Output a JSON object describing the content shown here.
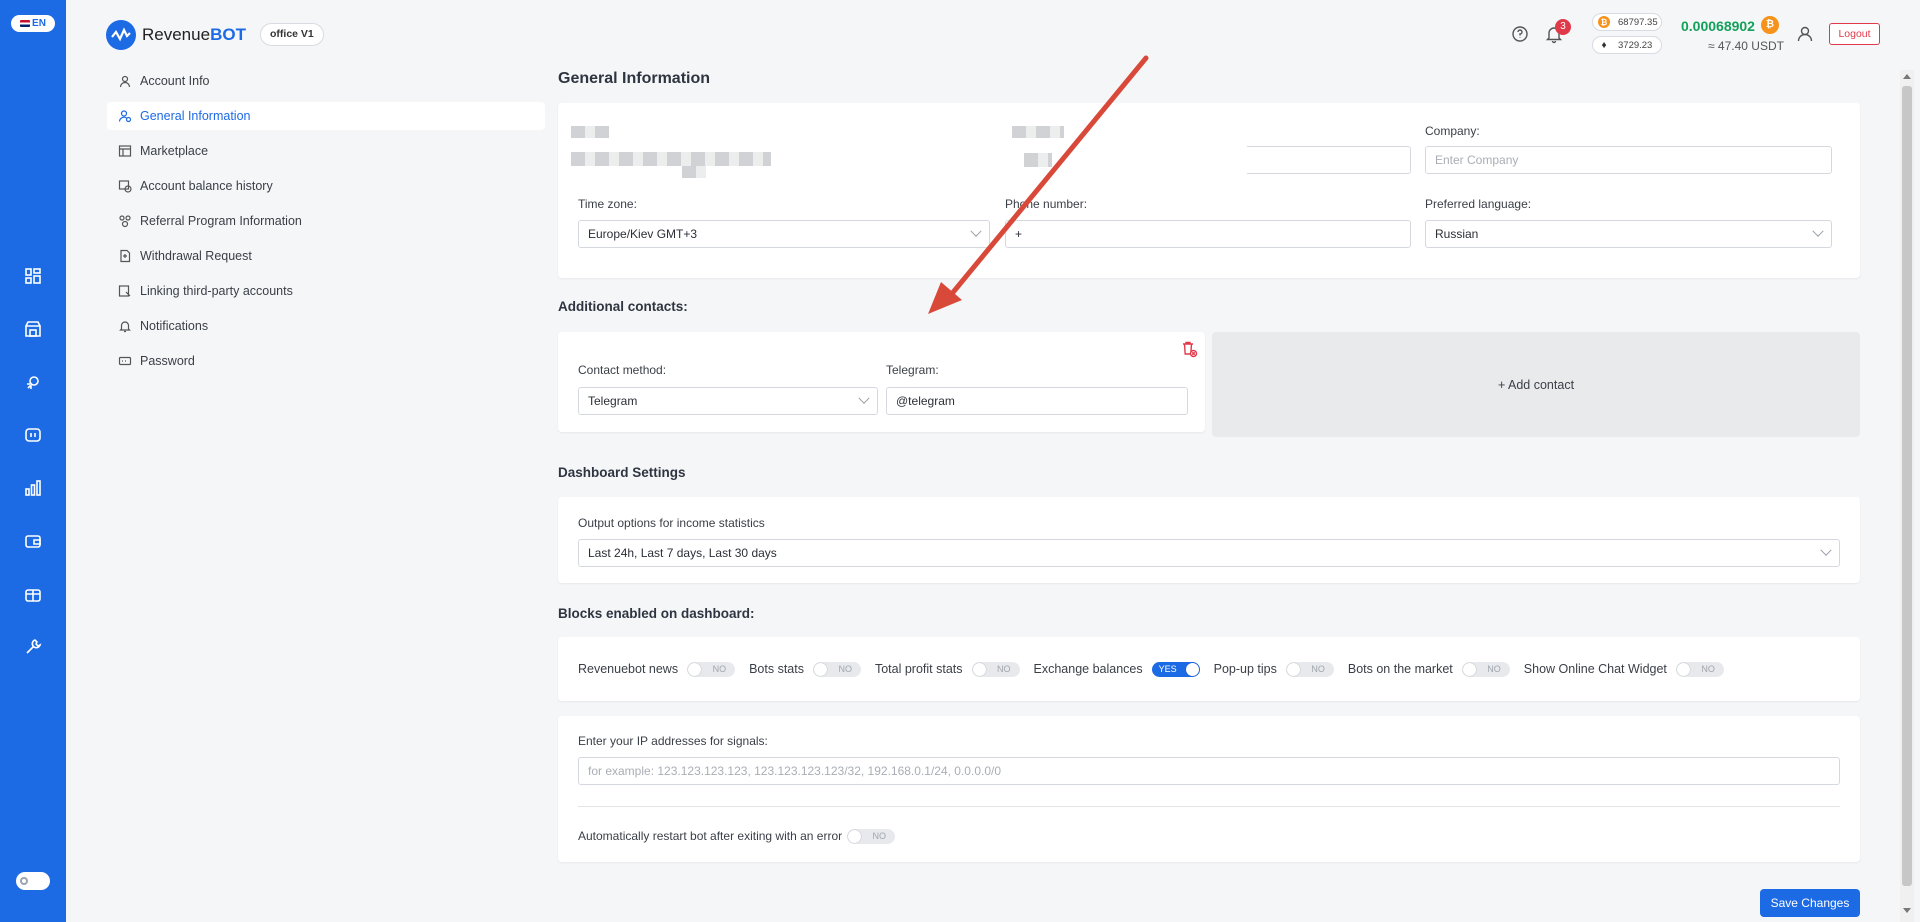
{
  "header": {
    "lang": "EN",
    "brand_first": "Revenue",
    "brand_second": "BOT",
    "office_badge": "office V1",
    "notifications_count": "3",
    "btc_price": "68797.35",
    "eth_price": "3729.23",
    "balance_btc": "0.00068902",
    "balance_usdt": "≈ 47.40 USDT",
    "logout_label": "Logout"
  },
  "menu": {
    "items": [
      {
        "label": "Account Info",
        "icon": "user-icon"
      },
      {
        "label": "General Information",
        "icon": "user-settings-icon"
      },
      {
        "label": "Marketplace",
        "icon": "marketplace-icon"
      },
      {
        "label": "Account balance history",
        "icon": "history-icon"
      },
      {
        "label": "Referral Program Information",
        "icon": "referral-icon"
      },
      {
        "label": "Withdrawal Request",
        "icon": "withdrawal-icon"
      },
      {
        "label": "Linking third-party accounts",
        "icon": "link-icon"
      },
      {
        "label": "Notifications",
        "icon": "bell-icon"
      },
      {
        "label": "Password",
        "icon": "password-icon"
      }
    ]
  },
  "general": {
    "title": "General Information",
    "company_label": "Company:",
    "company_placeholder": "Enter Company",
    "timezone_label": "Time zone:",
    "timezone_value": "Europe/Kiev GMT+3",
    "phone_label": "Phone number:",
    "phone_value": "+",
    "language_label": "Preferred language:",
    "language_value": "Russian"
  },
  "contacts": {
    "title": "Additional contacts:",
    "method_label": "Contact method:",
    "method_value": "Telegram",
    "telegram_label": "Telegram:",
    "telegram_value": "@telegram",
    "add_label": "+ Add contact"
  },
  "dashboard": {
    "title": "Dashboard Settings",
    "output_label": "Output options for income statistics",
    "output_value": "Last 24h, Last 7 days, Last 30 days"
  },
  "blocks": {
    "title": "Blocks enabled on dashboard:",
    "toggles": [
      {
        "label": "Revenuebot news",
        "state": "NO"
      },
      {
        "label": "Bots stats",
        "state": "NO"
      },
      {
        "label": "Total profit stats",
        "state": "NO"
      },
      {
        "label": "Exchange balances",
        "state": "YES"
      },
      {
        "label": "Pop-up tips",
        "state": "NO"
      },
      {
        "label": "Bots on the market",
        "state": "NO"
      },
      {
        "label": "Show Online Chat Widget",
        "state": "NO"
      }
    ]
  },
  "signals": {
    "ip_label": "Enter your IP addresses for signals:",
    "ip_placeholder": "for example: 123.123.123.123, 123.123.123.123/32, 192.168.0.1/24, 0.0.0.0/0",
    "restart_label": "Automatically restart bot after exiting with an error",
    "restart_state": "NO"
  },
  "save_label": "Save Changes",
  "colors": {
    "accent": "#1d6ae5",
    "success": "#13a05a",
    "danger": "#e0394a",
    "annotation_arrow": "#d9493a"
  }
}
